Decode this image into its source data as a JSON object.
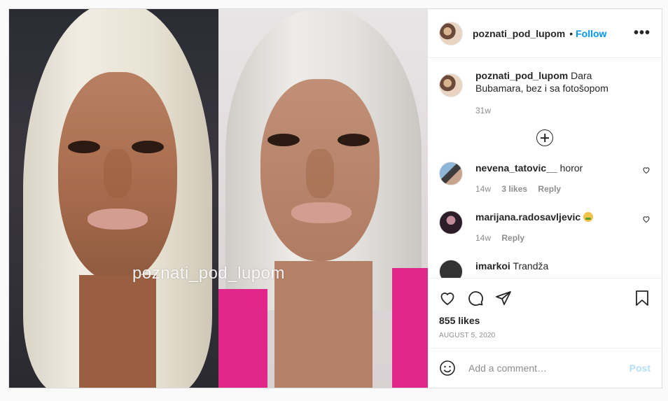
{
  "media": {
    "watermark": "poznati_pod_lupom"
  },
  "header": {
    "username": "poznati_pod_lupom",
    "separator": "•",
    "follow_label": "Follow",
    "more_label": "•••"
  },
  "caption": {
    "username": "poznati_pod_lupom",
    "text": "Dara Bubamara, bez i sa fotošopom",
    "time": "31w"
  },
  "comments": [
    {
      "username": "nevena_tatovic__",
      "text": "horor",
      "time": "14w",
      "likes": "3 likes",
      "reply": "Reply"
    },
    {
      "username": "marijana.radosavljevic",
      "text": "",
      "time": "14w",
      "likes": "",
      "reply": "Reply",
      "emoji": "nauseated-face-emoji"
    },
    {
      "username": "imarkoi",
      "text": "Trandža",
      "time": "",
      "likes": "",
      "reply": ""
    }
  ],
  "actions": {
    "likes": "855 likes",
    "date": "August 5, 2020"
  },
  "add_comment": {
    "placeholder": "Add a comment…",
    "post_label": "Post"
  },
  "colors": {
    "accent": "#0095f6",
    "post_disabled": "#b2dffc",
    "muted": "#8e8e8e",
    "jacket": "#e0288a"
  }
}
